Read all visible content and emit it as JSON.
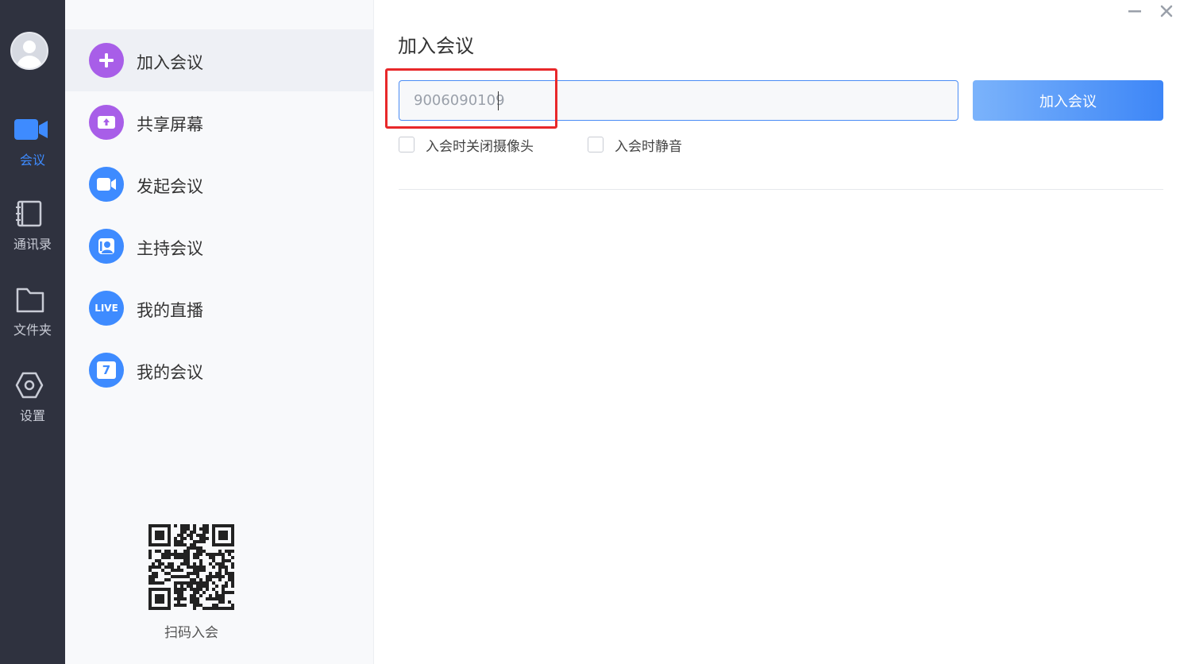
{
  "rail": {
    "items": [
      {
        "label": "会议",
        "icon": "video-camera-icon",
        "active": true
      },
      {
        "label": "通讯录",
        "icon": "address-book-icon",
        "active": false
      },
      {
        "label": "文件夹",
        "icon": "folder-icon",
        "active": false
      },
      {
        "label": "设置",
        "icon": "settings-hexagon-icon",
        "active": false
      }
    ]
  },
  "menu": {
    "items": [
      {
        "label": "加入会议",
        "icon": "plus-icon",
        "color": "#9b5de5"
      },
      {
        "label": "共享屏幕",
        "icon": "share-screen-icon",
        "color": "#9b5de5"
      },
      {
        "label": "发起会议",
        "icon": "video-icon",
        "color": "#3e8bff"
      },
      {
        "label": "主持会议",
        "icon": "host-user-icon",
        "color": "#3e8bff"
      },
      {
        "label": "我的直播",
        "icon": "live-icon",
        "icon_text": "LIVE",
        "color": "#3e8bff"
      },
      {
        "label": "我的会议",
        "icon": "calendar-icon",
        "icon_text": "7",
        "color": "#3e8bff"
      }
    ],
    "qr_label": "扫码入会"
  },
  "main": {
    "title": "加入会议",
    "meeting_id_value": "9006090109",
    "join_button_label": "加入会议",
    "options": [
      {
        "label": "入会时关闭摄像头",
        "checked": false
      },
      {
        "label": "入会时静音",
        "checked": false
      }
    ]
  },
  "colors": {
    "rail_bg": "#2f323f",
    "accent": "#3e8bff",
    "purple": "#9b5de5",
    "highlight": "#e8282a"
  }
}
